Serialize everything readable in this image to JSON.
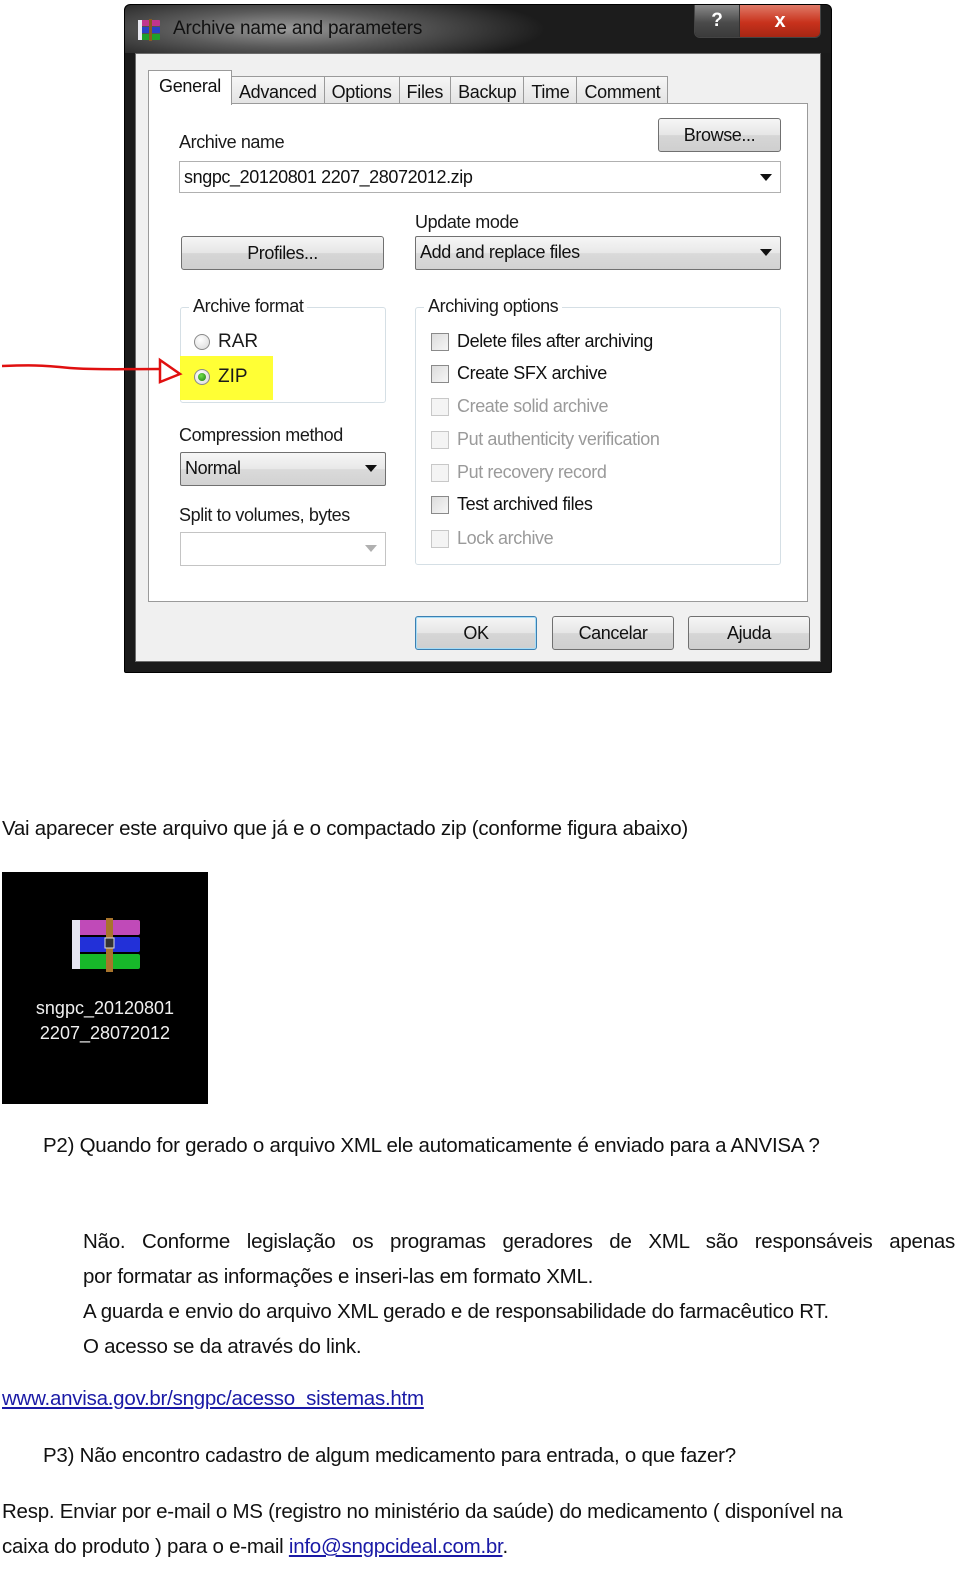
{
  "dialog": {
    "title": "Archive name and parameters",
    "title_icon": "winrar-books-icon",
    "help_button": "?",
    "close_button": "x",
    "tabs": [
      {
        "label": "General",
        "active": true
      },
      {
        "label": "Advanced",
        "active": false
      },
      {
        "label": "Options",
        "active": false
      },
      {
        "label": "Files",
        "active": false
      },
      {
        "label": "Backup",
        "active": false
      },
      {
        "label": "Time",
        "active": false
      },
      {
        "label": "Comment",
        "active": false
      }
    ],
    "archive_name_label": "Archive name",
    "browse_button": "Browse...",
    "archive_name_value": "sngpc_20120801 2207_28072012.zip",
    "profiles_button": "Profiles...",
    "update_mode_label": "Update mode",
    "update_mode_value": "Add and replace files",
    "archive_format": {
      "legend": "Archive format",
      "options": [
        {
          "label": "RAR",
          "selected": false
        },
        {
          "label": "ZIP",
          "selected": true
        }
      ]
    },
    "compression_method_label": "Compression method",
    "compression_method_value": "Normal",
    "split_label": "Split to volumes, bytes",
    "split_value": "",
    "archiving_options": {
      "legend": "Archiving options",
      "items": [
        {
          "label": "Delete files after archiving",
          "checked": false,
          "enabled": true
        },
        {
          "label": "Create SFX archive",
          "checked": false,
          "enabled": true
        },
        {
          "label": "Create solid archive",
          "checked": false,
          "enabled": false
        },
        {
          "label": "Put authenticity verification",
          "checked": false,
          "enabled": false
        },
        {
          "label": "Put recovery record",
          "checked": false,
          "enabled": false
        },
        {
          "label": "Test archived files",
          "checked": false,
          "enabled": true
        },
        {
          "label": "Lock archive",
          "checked": false,
          "enabled": false
        }
      ]
    },
    "buttons": {
      "ok": "OK",
      "cancel": "Cancelar",
      "help": "Ajuda"
    },
    "annotation": {
      "highlight_color": "#ffff2a",
      "arrow_color": "#e01010"
    }
  },
  "document": {
    "line1": "Vai aparecer este arquivo que já e o compactado zip (conforme figura abaixo)",
    "file_icon": {
      "icon": "winrar-archive-icon",
      "caption_line1": "sngpc_20120801",
      "caption_line2": "2207_28072012"
    },
    "p2_question": "P2) Quando for gerado o arquivo XML ele automaticamente é enviado para a ANVISA ?",
    "p2_answer": [
      "Não. Conforme legislação os programas geradores de XML são responsáveis apenas",
      "por formatar as informações e inseri-las em formato XML.",
      "A guarda e envio do arquivo XML gerado e de responsabilidade do farmacêutico RT.",
      "O acesso se da através do link."
    ],
    "link": "www.anvisa.gov.br/sngpc/acesso_sistemas.htm",
    "p3_question": "P3) Não encontro cadastro de algum medicamento para entrada, o que fazer?",
    "p3_answer_line1": "Resp. Enviar por e-mail o MS (registro no ministério da saúde)  do medicamento ( disponível na",
    "p3_answer_line2_prefix": "caixa do produto ) para o e-mail ",
    "email": "info@sngpcideal.com.br",
    "p3_answer_line2_suffix": ".",
    "link_color": "#1a1aa6"
  }
}
